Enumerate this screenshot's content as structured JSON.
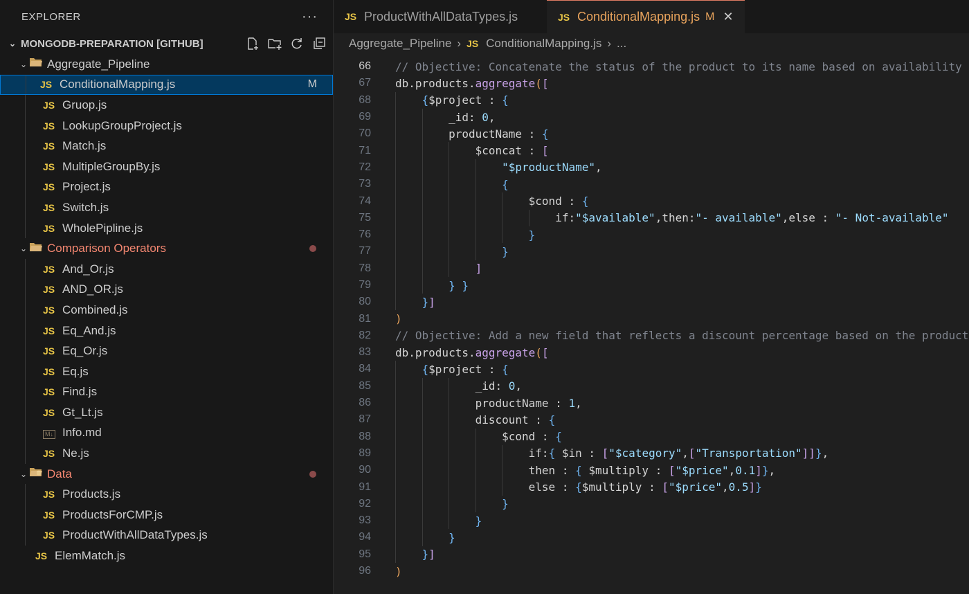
{
  "sidebar": {
    "title": "EXPLORER",
    "more": "···",
    "root": "MONGODB-PREPARATION [GITHUB]",
    "folders": [
      {
        "name": "Aggregate_Pipeline",
        "files": [
          {
            "name": "ConditionalMapping.js",
            "badge": "M"
          },
          {
            "name": "Gruop.js"
          },
          {
            "name": "LookupGroupProject.js"
          },
          {
            "name": "Match.js"
          },
          {
            "name": "MultipleGroupBy.js"
          },
          {
            "name": "Project.js"
          },
          {
            "name": "Switch.js"
          },
          {
            "name": "WholePipline.js"
          }
        ]
      },
      {
        "name": "Comparison Operators",
        "files": [
          {
            "name": "And_Or.js"
          },
          {
            "name": "AND_OR.js"
          },
          {
            "name": "Combined.js"
          },
          {
            "name": "Eq_And.js"
          },
          {
            "name": "Eq_Or.js"
          },
          {
            "name": "Eq.js"
          },
          {
            "name": "Find.js"
          },
          {
            "name": "Gt_Lt.js"
          },
          {
            "name": "Info.md"
          },
          {
            "name": "Ne.js"
          }
        ]
      },
      {
        "name": "Data",
        "files": [
          {
            "name": "Products.js"
          },
          {
            "name": "ProductsForCMP.js"
          },
          {
            "name": "ProductWithAllDataTypes.js"
          }
        ]
      }
    ],
    "root_file": "ElemMatch.js"
  },
  "tabs": [
    {
      "label": "ProductWithAllDataTypes.js",
      "badge": "JS"
    },
    {
      "label": "ConditionalMapping.js",
      "badge": "JS",
      "modified": "M"
    }
  ],
  "breadcrumb": {
    "folder": "Aggregate_Pipeline",
    "file": "ConditionalMapping.js",
    "more": "..."
  },
  "editor": {
    "current_line": 66,
    "line_numbers": [
      66,
      67,
      68,
      69,
      70,
      71,
      72,
      73,
      74,
      75,
      76,
      77,
      78,
      79,
      80,
      81,
      82,
      83,
      84,
      85,
      86,
      87,
      88,
      89,
      90,
      91,
      92,
      93,
      94,
      95,
      96
    ],
    "lines": [
      "// Objective: Concatenate the status of the product to its name based on availability",
      "db.products.aggregate([",
      "    {$project : {",
      "        _id: 0,",
      "        productName : {",
      "            $concat : [",
      "                \"$productName\",",
      "                {",
      "                    $cond : {",
      "                        if:\"$available\",then:\"- available\",else : \"- Not-available\"",
      "                    }",
      "                }",
      "            ]",
      "        } }",
      "    }]",
      ")",
      "// Objective: Add a new field that reflects a discount percentage based on the product",
      "db.products.aggregate([",
      "    {$project : {",
      "            _id: 0,",
      "            productName : 1,",
      "            discount : {",
      "                $cond : {",
      "                    if:{ $in : [\"$category\",[\"Transportation\"]]},",
      "                    then : { $multiply : [\"$price\",0.1]},",
      "                    else : {$multiply : [\"$price\",0.5]}",
      "                }",
      "            }",
      "        }",
      "    }]",
      ")"
    ]
  }
}
